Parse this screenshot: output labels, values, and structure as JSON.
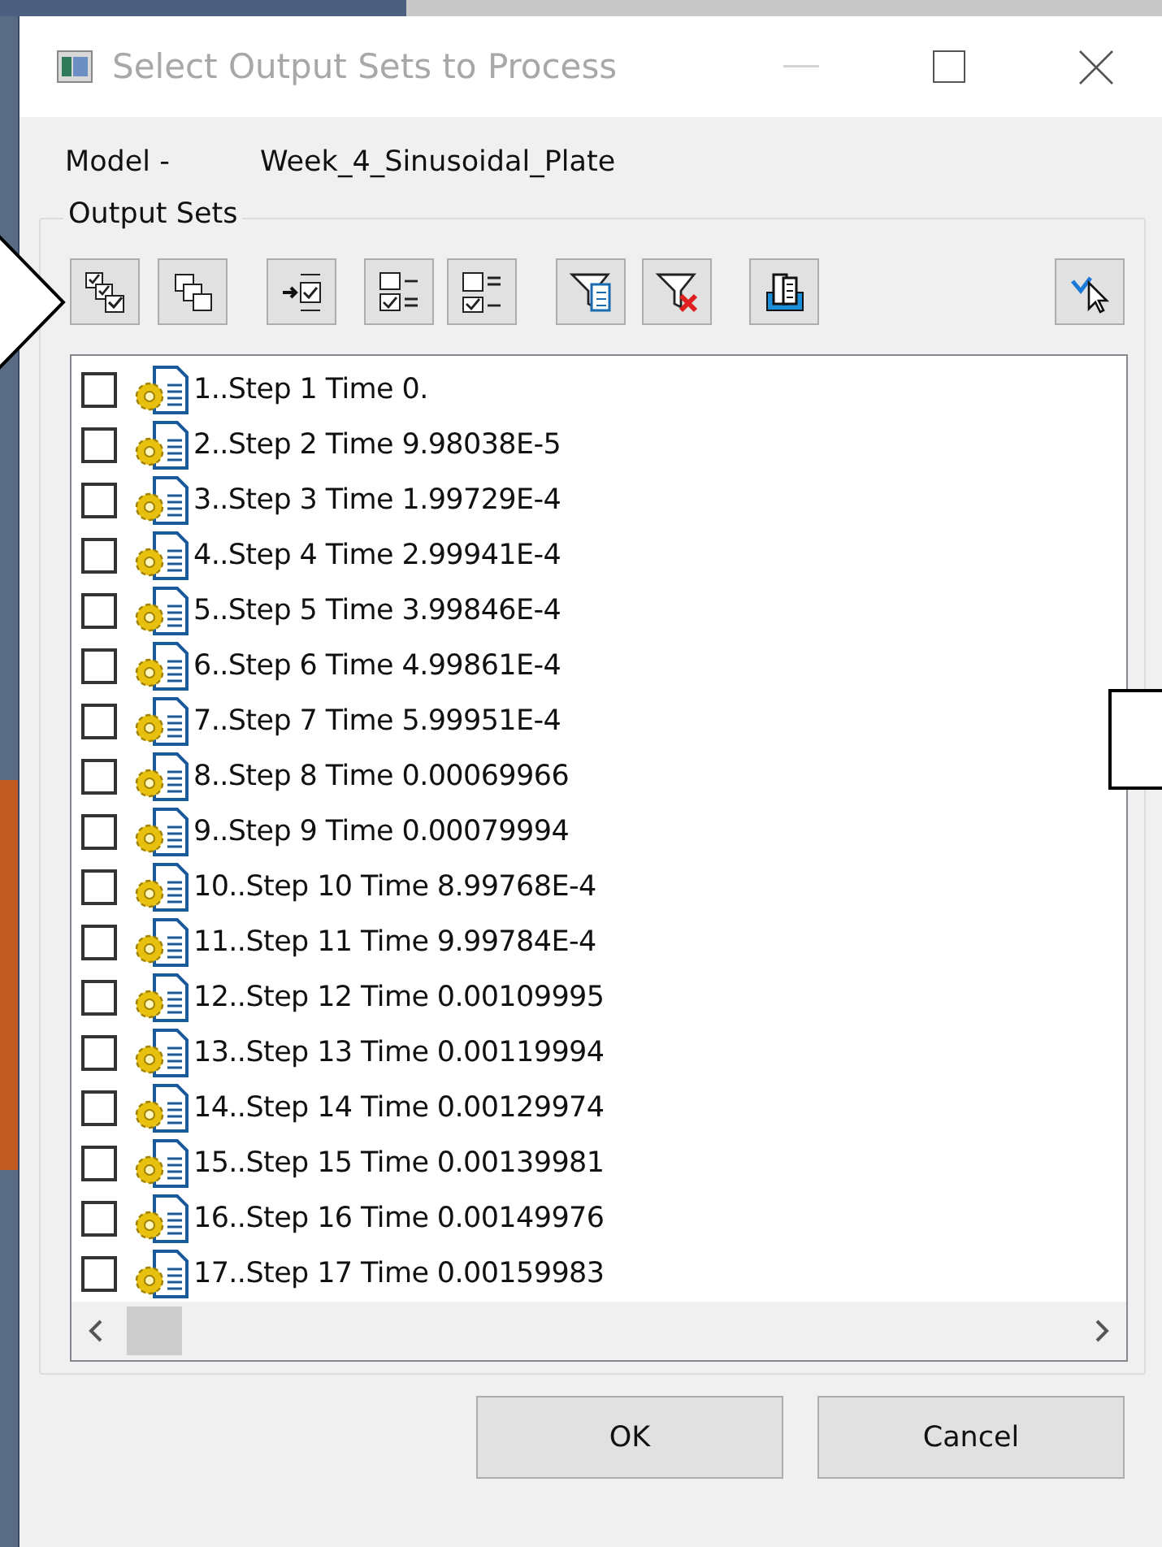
{
  "window": {
    "title": "Select Output Sets to Process",
    "active": false
  },
  "model": {
    "label": "Model -",
    "value": "Week_4_Sinusoidal_Plate"
  },
  "output_sets": {
    "label": "Output Sets",
    "items": [
      {
        "text": "1..Step 1 Time 0.",
        "checked": false
      },
      {
        "text": "2..Step 2 Time 9.98038E-5",
        "checked": false
      },
      {
        "text": "3..Step 3 Time 1.99729E-4",
        "checked": false
      },
      {
        "text": "4..Step 4 Time 2.99941E-4",
        "checked": false
      },
      {
        "text": "5..Step 5 Time 3.99846E-4",
        "checked": false
      },
      {
        "text": "6..Step 6 Time 4.99861E-4",
        "checked": false
      },
      {
        "text": "7..Step 7 Time 5.99951E-4",
        "checked": false
      },
      {
        "text": "8..Step 8 Time 0.00069966",
        "checked": false
      },
      {
        "text": "9..Step 9 Time 0.00079994",
        "checked": false
      },
      {
        "text": "10..Step 10 Time 8.99768E-4",
        "checked": false
      },
      {
        "text": "11..Step 11 Time 9.99784E-4",
        "checked": false
      },
      {
        "text": "12..Step 12 Time 0.00109995",
        "checked": false
      },
      {
        "text": "13..Step 13 Time 0.00119994",
        "checked": false
      },
      {
        "text": "14..Step 14 Time 0.00129974",
        "checked": false
      },
      {
        "text": "15..Step 15 Time 0.00139981",
        "checked": false
      },
      {
        "text": "16..Step 16 Time 0.00149976",
        "checked": false
      },
      {
        "text": "17..Step 17 Time 0.00159983",
        "checked": false
      }
    ]
  },
  "buttons": [
    "OK",
    "Cancel"
  ]
}
